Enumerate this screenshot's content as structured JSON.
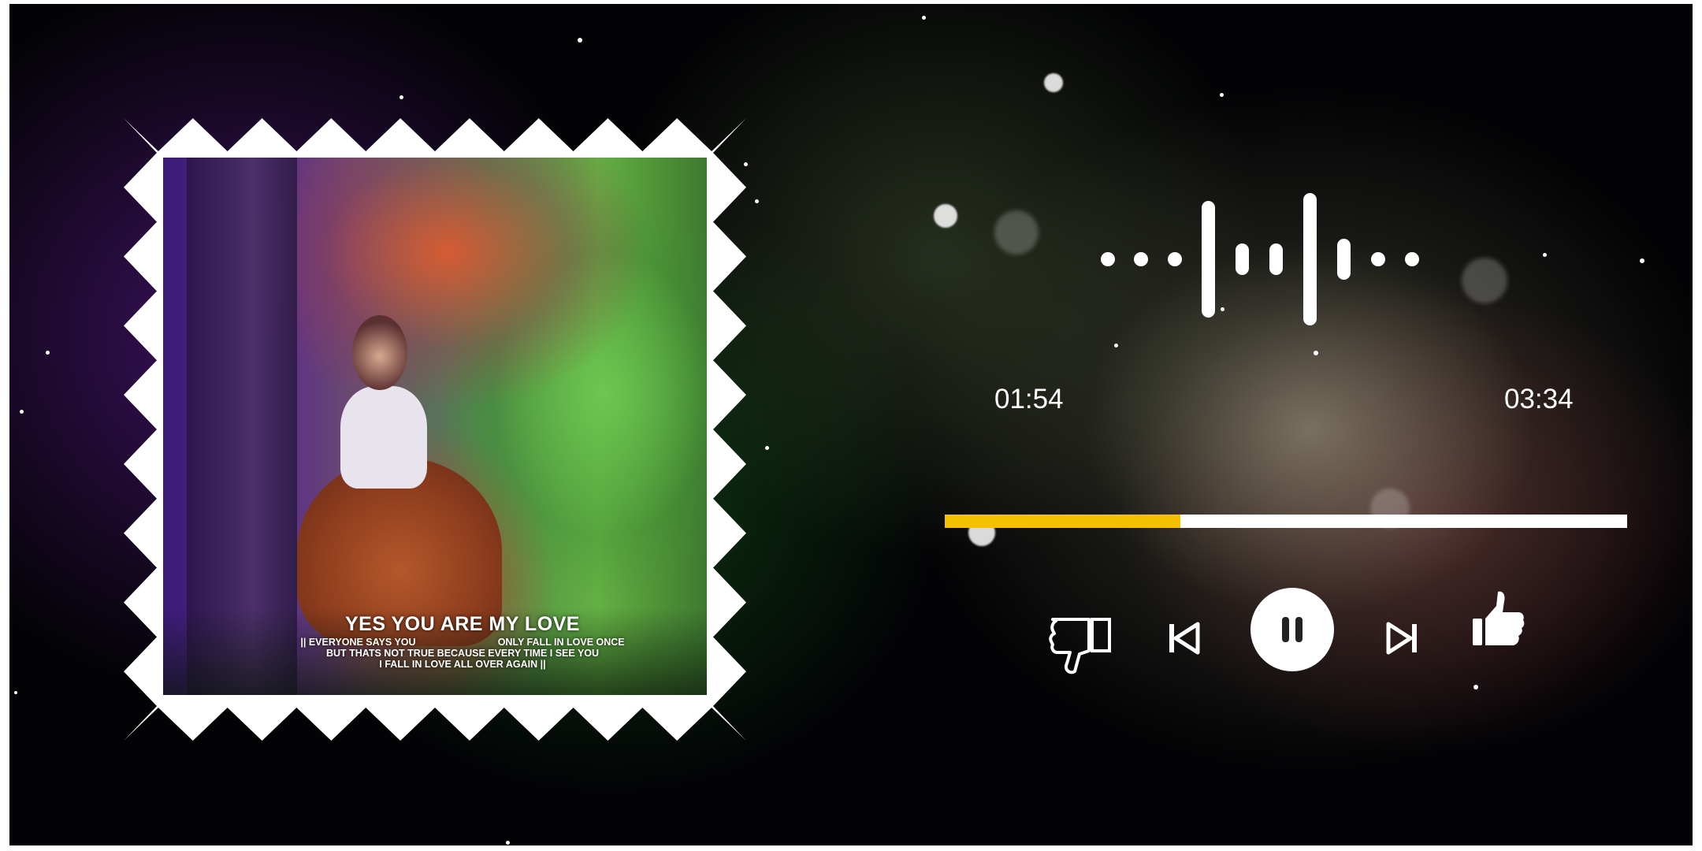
{
  "player": {
    "elapsed": "01:54",
    "duration": "03:34",
    "progress_fraction": 0.345,
    "accent_color": "#f5c000",
    "state": "playing"
  },
  "artwork": {
    "title": "YES YOU ARE MY LOVE",
    "line1": "|| EVERYONE SAYS YOU                              ONLY FALL IN LOVE ONCE",
    "line2": "BUT THATS NOT TRUE BECAUSE EVERY TIME I SEE YOU",
    "line3": "I FALL IN LOVE ALL OVER AGAIN ||"
  },
  "controls": {
    "dislike_icon": "thumbs-down-icon",
    "previous_icon": "skip-previous-icon",
    "pause_icon": "pause-icon",
    "next_icon": "skip-next-icon",
    "like_icon": "thumbs-up-icon"
  },
  "visualizer_icon": "audio-waveform-icon"
}
